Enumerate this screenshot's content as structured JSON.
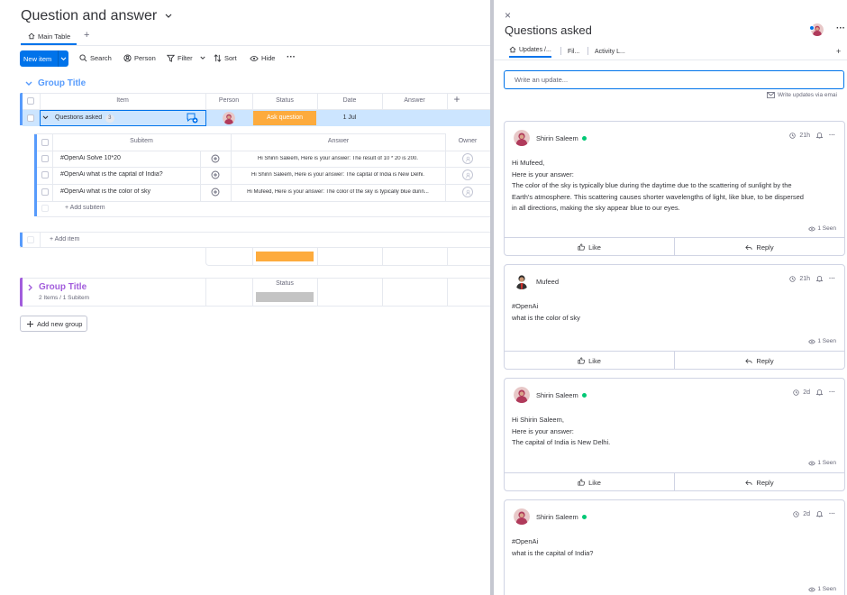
{
  "board": {
    "title": "Question and answer",
    "tab_main": "Main Table",
    "tab_add": "+",
    "new_item": "New item",
    "toolbar": [
      "Search",
      "Person",
      "Filter",
      "Sort",
      "Hide"
    ],
    "more": "···",
    "group1": {
      "title": "Group Title",
      "columns": [
        "Item",
        "Person",
        "Status",
        "Date",
        "Answer",
        "+"
      ],
      "row": {
        "name": "Questions asked",
        "count": "3",
        "status": "Ask question",
        "date": "1 Jul"
      },
      "subitems_header": [
        "Subitem",
        "Answer",
        "Owner"
      ],
      "subitems": [
        {
          "name": "#OpenAi Solve 10*20",
          "answer": "Hi Shirin Saleem, Here is your answer: The result of 10 * 20 is 200."
        },
        {
          "name": "#OpenAi what is the capital of India?",
          "answer": "Hi Shirin Saleem, Here is your answer: The capital of India is New Delhi."
        },
        {
          "name": "#OpenAi what is the color of sky",
          "answer": "Hi Mufeed, Here is your answer: The color of the sky is typically blue durin..."
        }
      ],
      "add_subitem": "+ Add subitem",
      "add_item": "+ Add item"
    },
    "group2": {
      "title": "Group Title",
      "summary": "2 Items / 1 Subitem",
      "status_col": "Status"
    },
    "add_group": "Add new group",
    "colors": {
      "accent": "#0073ea",
      "group1": "#579bfc",
      "group2": "#a25ddc",
      "status_orange": "#fdab3d",
      "status_grey": "#c4c4c4"
    }
  },
  "panel": {
    "close": "×",
    "title": "Questions asked",
    "more": "···",
    "tabs": [
      "Updates /...",
      "Fil...",
      "Activity L...",
      "+"
    ],
    "input_placeholder": "Write an update...",
    "write_email": "Write updates via emai",
    "like": "Like",
    "reply": "Reply",
    "cards": [
      {
        "author": "Shirin Saleem",
        "online": true,
        "time": "21h",
        "lines": [
          "Hi Mufeed,",
          "Here is your answer:",
          "The color of the sky is typically blue during the daytime due to the scattering of sunlight by the",
          "Earth's atmosphere. This scattering causes shorter wavelengths of light, like blue, to be dispersed",
          "in all directions, making the sky appear blue to our eyes."
        ],
        "seen": "1 Seen"
      },
      {
        "author": "Mufeed",
        "online": false,
        "time": "21h",
        "lines": [
          "#OpenAi",
          "what is the color of sky"
        ],
        "seen": "1 Seen"
      },
      {
        "author": "Shirin Saleem",
        "online": true,
        "time": "2d",
        "lines": [
          "Hi Shirin Saleem,",
          "Here is your answer:",
          "The capital of India is New Delhi."
        ],
        "seen": "1 Seen"
      },
      {
        "author": "Shirin Saleem",
        "online": true,
        "time": "2d",
        "lines": [
          "#OpenAi",
          "what is the capital of India?"
        ],
        "seen": "1 Seen"
      }
    ]
  }
}
